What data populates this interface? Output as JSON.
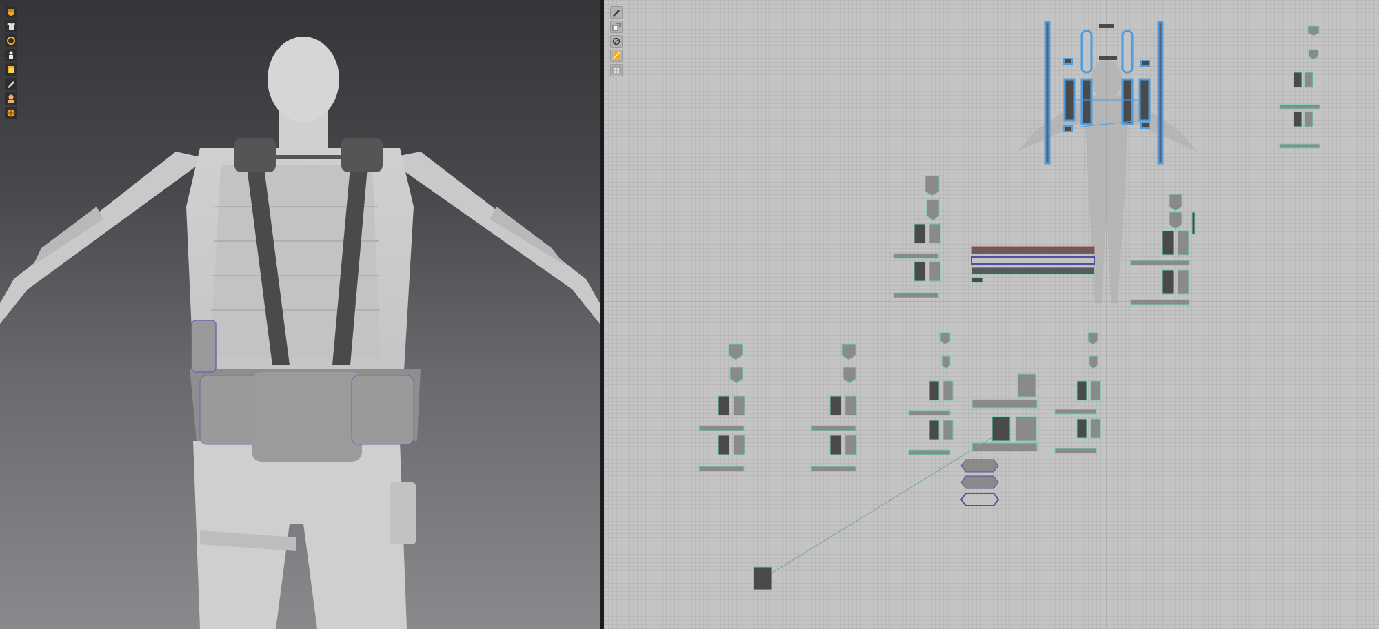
{
  "app": {
    "accent_color": "#f0b020",
    "selection_color": "#4d9de0",
    "seam_color": "#6fcfb0"
  },
  "viewport3d": {
    "toolbar": [
      {
        "icon": "avatar-hair-icon"
      },
      {
        "icon": "garment-shirt-icon"
      },
      {
        "icon": "simulation-cycle-icon"
      },
      {
        "icon": "avatar-figure-icon"
      },
      {
        "icon": "fabric-layers-icon"
      },
      {
        "icon": "texture-brush-icon"
      },
      {
        "icon": "avatar-body-icon"
      },
      {
        "icon": "globe-render-icon"
      }
    ]
  },
  "pattern2d": {
    "toolbar": [
      {
        "icon": "pattern-edit-icon"
      },
      {
        "icon": "arrangement-icon"
      },
      {
        "icon": "sewing-icon"
      },
      {
        "icon": "fabric-icon"
      },
      {
        "icon": "grid-icon"
      }
    ]
  }
}
